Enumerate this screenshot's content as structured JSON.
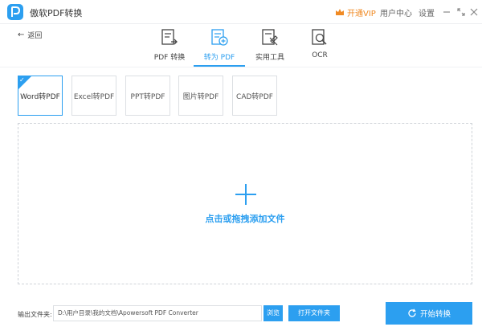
{
  "titlebar": {
    "app_title": "傲软PDF转换",
    "vip_label": "开通VIP",
    "user_center": "用户中心",
    "settings": "设置"
  },
  "nav": {
    "back_label": "返回"
  },
  "tabs": [
    {
      "label": "PDF 转换",
      "icon": "pdf-convert-icon",
      "active": false
    },
    {
      "label": "转为 PDF",
      "icon": "to-pdf-icon",
      "active": true
    },
    {
      "label": "实用工具",
      "icon": "tools-icon",
      "active": false
    },
    {
      "label": "OCR",
      "icon": "ocr-icon",
      "active": false
    }
  ],
  "options": [
    {
      "label": "Word转PDF",
      "selected": true
    },
    {
      "label": "Excel转PDF",
      "selected": false
    },
    {
      "label": "PPT转PDF",
      "selected": false
    },
    {
      "label": "图片转PDF",
      "selected": false
    },
    {
      "label": "CAD转PDF",
      "selected": false
    }
  ],
  "dropzone": {
    "text": "点击或拖拽添加文件"
  },
  "output": {
    "label": "输出文件夹:",
    "path": "D:\\用户目录\\我的文档\\Apowersoft PDF Converter",
    "browse_label": "浏览",
    "open_folder_label": "打开文件夹"
  },
  "start_button_label": "开始转换",
  "colors": {
    "accent": "#2c9ff0",
    "vip": "#f08a24"
  }
}
